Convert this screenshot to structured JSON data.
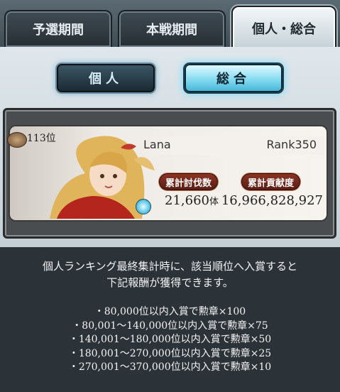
{
  "tabs": [
    {
      "label": "予選期間",
      "active": false
    },
    {
      "label": "本戦期間",
      "active": false
    },
    {
      "label": "個人・総合",
      "active": true
    }
  ],
  "subtabs": [
    {
      "label": "個人",
      "active": false
    },
    {
      "label": "総合",
      "active": true
    }
  ],
  "player": {
    "rank_position": "113位",
    "name": "Lana",
    "rank": "Rank350",
    "stats": [
      {
        "label": "累計討伐数",
        "value": "21,660",
        "unit": "体"
      },
      {
        "label": "累計貢献度",
        "value": "16,966,828,927",
        "unit": ""
      }
    ]
  },
  "info": {
    "description_lines": [
      "個人ランキング最終集計時に、該当順位へ入賞すると",
      "下記報酬が獲得できます。"
    ],
    "rewards": [
      "・80,000位以内入賞で勲章×100",
      "・80,001〜140,000位以内入賞で勲章×75",
      "・140,001〜180,000位以内入賞で勲章×50",
      "・180,001〜270,000位以内入賞で勲章×25",
      "・270,001〜370,000位以内入賞で勲章×10"
    ]
  },
  "colors": {
    "active_tab": "#e8f0f4",
    "stat_label_bg": "#6e2a1c",
    "info_bg": "#2c3338"
  },
  "icons": {
    "rank_badge": "medal-icon",
    "element": "water-orb-icon"
  }
}
